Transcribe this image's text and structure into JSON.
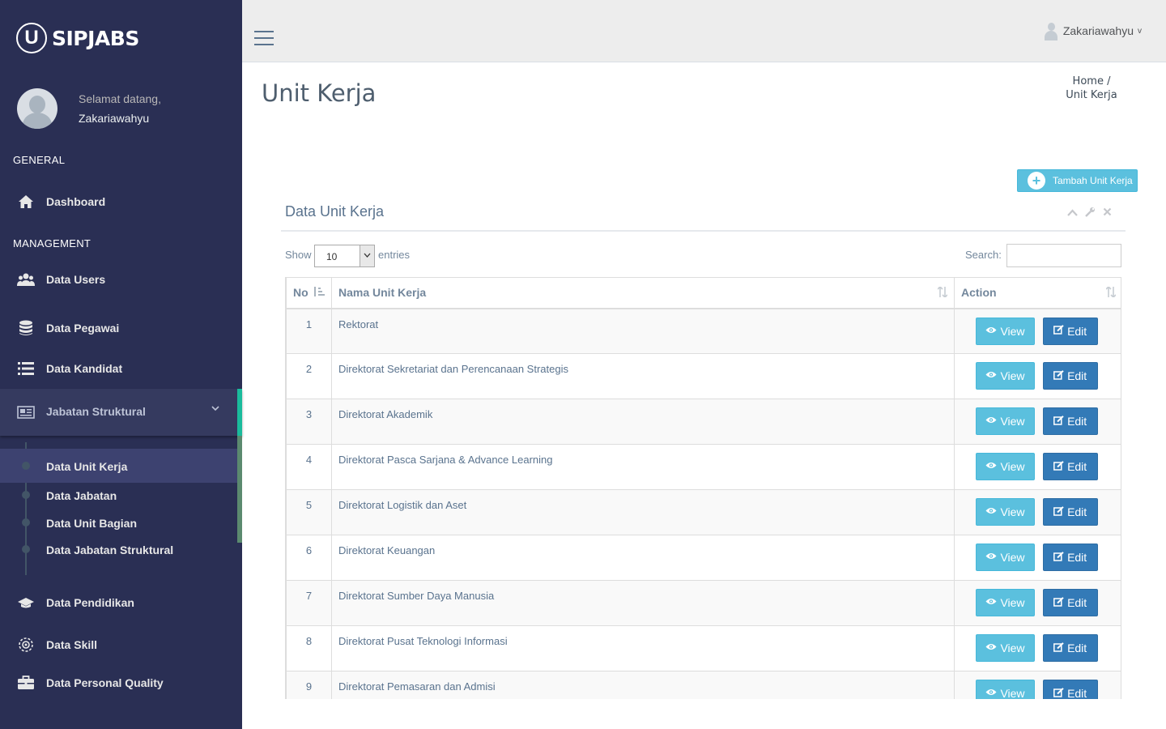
{
  "brand": {
    "logo_letter": "U",
    "name": "SIPJABS"
  },
  "profile": {
    "welcome": "Selamat datang,",
    "username": "Zakariawahyu"
  },
  "sidebar": {
    "sections": {
      "general": "GENERAL",
      "management": "MANAGEMENT"
    },
    "items": {
      "dashboard": "Dashboard",
      "data_users": "Data Users",
      "data_pegawai": "Data Pegawai",
      "data_kandidat": "Data Kandidat",
      "jabatan_struktural": "Jabatan Struktural",
      "data_pendidikan": "Data Pendidikan",
      "data_skill": "Data Skill",
      "data_personal_quality": "Data Personal Quality"
    },
    "submenu": {
      "data_unit_kerja": "Data Unit Kerja",
      "data_jabatan": "Data Jabatan",
      "data_unit_bagian": "Data Unit Bagian",
      "data_jabatan_struktural": "Data Jabatan Struktural"
    }
  },
  "topnav": {
    "user": "Zakariawahyu",
    "caret": "v"
  },
  "page": {
    "title": "Unit Kerja",
    "breadcrumb": {
      "home": "Home /",
      "current": "Unit Kerja"
    },
    "add_button": "Tambah Unit Kerja"
  },
  "panel": {
    "title": "Data Unit Kerja",
    "show_label": "Show",
    "show_value": "10",
    "entries_label": "entries",
    "search_label": "Search:"
  },
  "table": {
    "headers": {
      "no": "No",
      "name": "Nama Unit Kerja",
      "action": "Action"
    },
    "view_label": "View",
    "edit_label": "Edit",
    "rows": [
      {
        "no": "1",
        "name": "Rektorat"
      },
      {
        "no": "2",
        "name": "Direktorat Sekretariat dan Perencanaan Strategis"
      },
      {
        "no": "3",
        "name": "Direktorat Akademik"
      },
      {
        "no": "4",
        "name": "Direktorat Pasca Sarjana & Advance Learning"
      },
      {
        "no": "5",
        "name": "Direktorat Logistik dan Aset"
      },
      {
        "no": "6",
        "name": "Direktorat Keuangan"
      },
      {
        "no": "7",
        "name": "Direktorat Sumber Daya Manusia"
      },
      {
        "no": "8",
        "name": "Direktorat Pusat Teknologi Informasi"
      },
      {
        "no": "9",
        "name": "Direktorat Pemasaran dan Admisi"
      }
    ]
  },
  "colors": {
    "sidebar": "#2a2f54",
    "accent_info": "#5bc0de",
    "accent_primary": "#337ab7",
    "active_border": "#1abb9c"
  }
}
